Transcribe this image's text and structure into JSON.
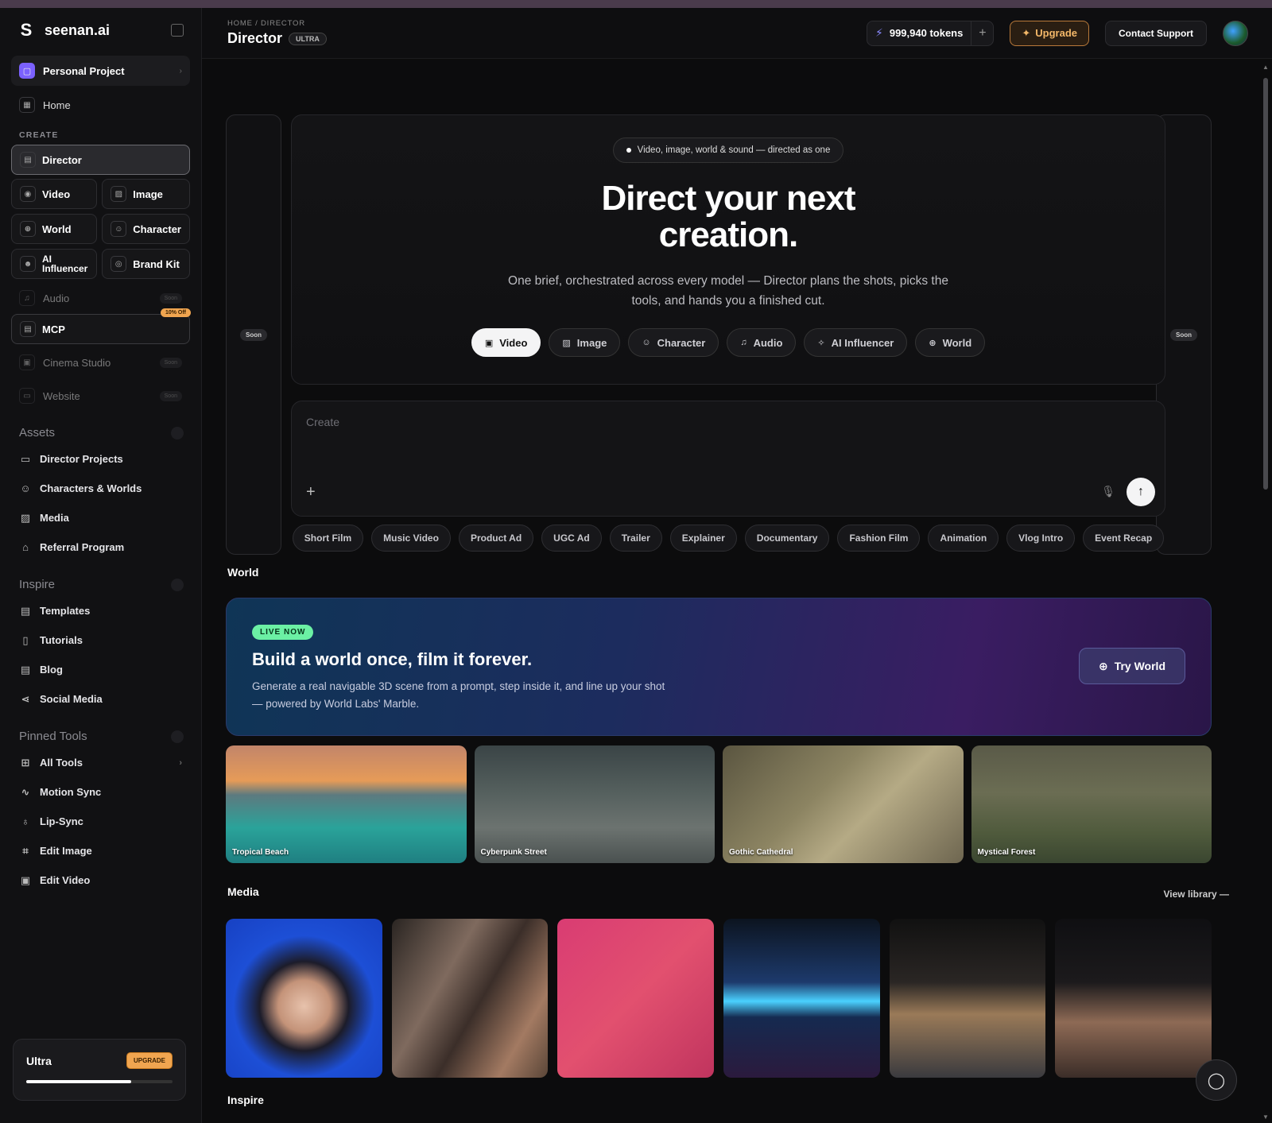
{
  "brand": {
    "name": "seenan.ai",
    "logo_char": "S"
  },
  "project": {
    "label": "Personal Project",
    "icon": "folder-icon"
  },
  "nav": {
    "home": "Home"
  },
  "create": {
    "heading": "CREATE",
    "director": "Director",
    "video": "Video",
    "image": "Image",
    "world": "World",
    "character": "Character",
    "ai_influencer": "AI Influencer",
    "brand_kit": "Brand Kit",
    "audio": "Audio",
    "audio_badge": "Soon",
    "mcp": "MCP",
    "mcp_badge": "10% Off",
    "cinema_studio": "Cinema Studio",
    "cinema_badge": "Soon",
    "website": "Website",
    "website_badge": "Soon"
  },
  "assets": {
    "heading": "Assets",
    "items": [
      "Director Projects",
      "Characters & Worlds",
      "Media",
      "Referral Program"
    ]
  },
  "inspire_nav": {
    "heading": "Inspire",
    "items": [
      "Templates",
      "Tutorials",
      "Blog",
      "Social Media"
    ]
  },
  "pinned": {
    "heading": "Pinned Tools",
    "items": [
      "All Tools",
      "Motion Sync",
      "Lip-Sync",
      "Edit Image",
      "Edit Video"
    ]
  },
  "plan": {
    "name": "Ultra",
    "upgrade": "UPGRADE",
    "usage_fraction": 0.72
  },
  "header": {
    "breadcrumb": "HOME / DIRECTOR",
    "title": "Director",
    "badge": "ULTRA",
    "tokens": "999,940 tokens",
    "upgrade": "Upgrade",
    "support": "Contact Support"
  },
  "side_cards": {
    "left": "Soon",
    "right": "Soon"
  },
  "hero": {
    "chip": "Video, image, world & sound — directed as one",
    "title_line1": "Direct your next",
    "title_line2": "creation.",
    "subtitle": "One brief, orchestrated across every model — Director plans the shots, picks the tools, and hands you a finished cut.",
    "modes": [
      "Video",
      "Image",
      "Character",
      "Audio",
      "AI Influencer",
      "World"
    ],
    "active_mode": "Video"
  },
  "composer": {
    "placeholder": "Create"
  },
  "presets": [
    "Short Film",
    "Music Video",
    "Product Ad",
    "UGC Ad",
    "Trailer",
    "Explainer",
    "Documentary",
    "Fashion Film",
    "Animation",
    "Vlog Intro",
    "Event Recap"
  ],
  "world_section": {
    "heading": "World",
    "badge": "LIVE NOW",
    "title": "Build a world once, film it forever.",
    "desc": "Generate a real navigable 3D scene from a prompt, step inside it, and line up your shot — powered by World Labs' Marble.",
    "cta": "Try World",
    "cards": [
      "Tropical Beach",
      "Cyberpunk Street",
      "Gothic Cathedral",
      "Mystical Forest"
    ]
  },
  "media_section": {
    "heading": "Media",
    "view_all": "View library —"
  },
  "inspire_section": {
    "heading": "Inspire"
  }
}
